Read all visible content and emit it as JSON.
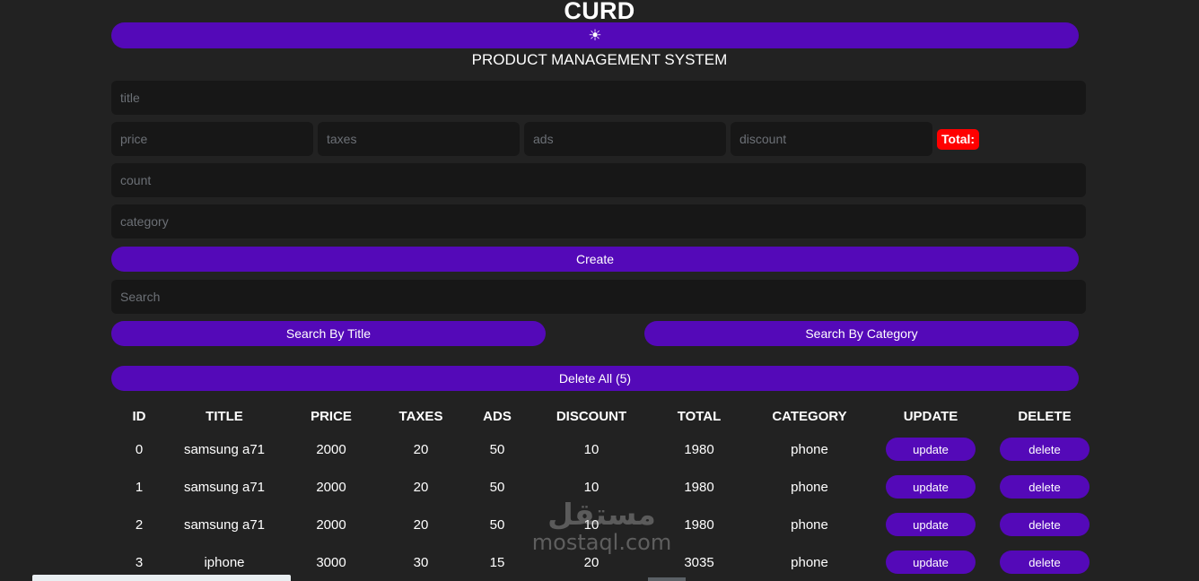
{
  "header": {
    "app_title": "CURD",
    "mode_toggle_icon": "sun-icon",
    "mode_toggle_glyph": "☀",
    "subtitle": "PRODUCT MANAGEMENT SYSTEM"
  },
  "form": {
    "title_placeholder": "title",
    "price_placeholder": "price",
    "taxes_placeholder": "taxes",
    "ads_placeholder": "ads",
    "discount_placeholder": "discount",
    "total_label": "Total:",
    "count_placeholder": "count",
    "category_placeholder": "category",
    "create_label": "Create",
    "title_value": "",
    "price_value": "",
    "taxes_value": "",
    "ads_value": "",
    "discount_value": "",
    "count_value": "",
    "category_value": ""
  },
  "search": {
    "placeholder": "Search",
    "value": "",
    "by_title_label": "Search By Title",
    "by_category_label": "Search By Category"
  },
  "actions": {
    "delete_all_label": "Delete All (5)"
  },
  "table": {
    "columns": [
      "ID",
      "TITLE",
      "PRICE",
      "TAXES",
      "ADS",
      "DISCOUNT",
      "TOTAL",
      "CATEGORY",
      "UPDATE",
      "DELETE"
    ],
    "update_label": "update",
    "delete_label": "delete",
    "rows": [
      {
        "id": "0",
        "title": "samsung a71",
        "price": "2000",
        "taxes": "20",
        "ads": "50",
        "discount": "10",
        "total": "1980",
        "category": "phone"
      },
      {
        "id": "1",
        "title": "samsung a71",
        "price": "2000",
        "taxes": "20",
        "ads": "50",
        "discount": "10",
        "total": "1980",
        "category": "phone"
      },
      {
        "id": "2",
        "title": "samsung a71",
        "price": "2000",
        "taxes": "20",
        "ads": "50",
        "discount": "10",
        "total": "1980",
        "category": "phone"
      },
      {
        "id": "3",
        "title": "iphone",
        "price": "3000",
        "taxes": "30",
        "ads": "15",
        "discount": "20",
        "total": "3035",
        "category": "phone"
      }
    ]
  },
  "watermark": {
    "arabic": "مستقل",
    "latin": "mostaql.com"
  },
  "colors": {
    "background": "#222222",
    "input_background": "#171717",
    "accent_purple": "#5409b8",
    "total_badge_red": "#ff0000",
    "text": "#ffffff",
    "placeholder": "#6c7076"
  }
}
